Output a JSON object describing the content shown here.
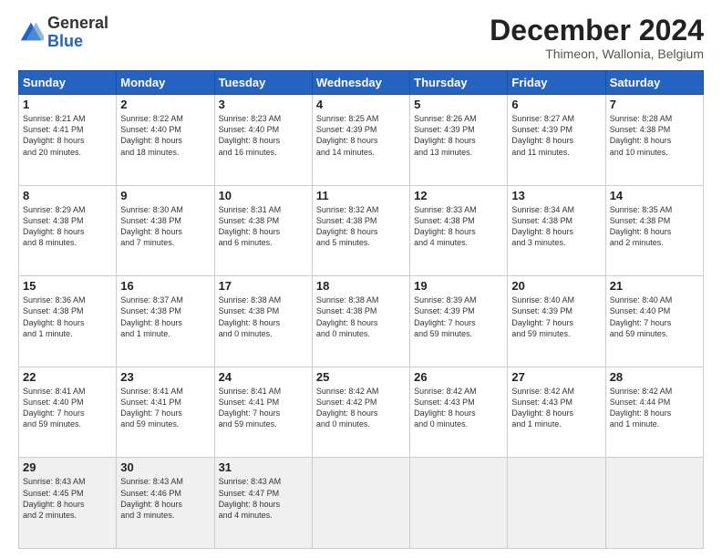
{
  "logo": {
    "general": "General",
    "blue": "Blue"
  },
  "header": {
    "month": "December 2024",
    "location": "Thimeon, Wallonia, Belgium"
  },
  "days_header": [
    "Sunday",
    "Monday",
    "Tuesday",
    "Wednesday",
    "Thursday",
    "Friday",
    "Saturday"
  ],
  "weeks": [
    [
      {
        "day": "1",
        "info": "Sunrise: 8:21 AM\nSunset: 4:41 PM\nDaylight: 8 hours\nand 20 minutes."
      },
      {
        "day": "2",
        "info": "Sunrise: 8:22 AM\nSunset: 4:40 PM\nDaylight: 8 hours\nand 18 minutes."
      },
      {
        "day": "3",
        "info": "Sunrise: 8:23 AM\nSunset: 4:40 PM\nDaylight: 8 hours\nand 16 minutes."
      },
      {
        "day": "4",
        "info": "Sunrise: 8:25 AM\nSunset: 4:39 PM\nDaylight: 8 hours\nand 14 minutes."
      },
      {
        "day": "5",
        "info": "Sunrise: 8:26 AM\nSunset: 4:39 PM\nDaylight: 8 hours\nand 13 minutes."
      },
      {
        "day": "6",
        "info": "Sunrise: 8:27 AM\nSunset: 4:39 PM\nDaylight: 8 hours\nand 11 minutes."
      },
      {
        "day": "7",
        "info": "Sunrise: 8:28 AM\nSunset: 4:38 PM\nDaylight: 8 hours\nand 10 minutes."
      }
    ],
    [
      {
        "day": "8",
        "info": "Sunrise: 8:29 AM\nSunset: 4:38 PM\nDaylight: 8 hours\nand 8 minutes."
      },
      {
        "day": "9",
        "info": "Sunrise: 8:30 AM\nSunset: 4:38 PM\nDaylight: 8 hours\nand 7 minutes."
      },
      {
        "day": "10",
        "info": "Sunrise: 8:31 AM\nSunset: 4:38 PM\nDaylight: 8 hours\nand 6 minutes."
      },
      {
        "day": "11",
        "info": "Sunrise: 8:32 AM\nSunset: 4:38 PM\nDaylight: 8 hours\nand 5 minutes."
      },
      {
        "day": "12",
        "info": "Sunrise: 8:33 AM\nSunset: 4:38 PM\nDaylight: 8 hours\nand 4 minutes."
      },
      {
        "day": "13",
        "info": "Sunrise: 8:34 AM\nSunset: 4:38 PM\nDaylight: 8 hours\nand 3 minutes."
      },
      {
        "day": "14",
        "info": "Sunrise: 8:35 AM\nSunset: 4:38 PM\nDaylight: 8 hours\nand 2 minutes."
      }
    ],
    [
      {
        "day": "15",
        "info": "Sunrise: 8:36 AM\nSunset: 4:38 PM\nDaylight: 8 hours\nand 1 minute."
      },
      {
        "day": "16",
        "info": "Sunrise: 8:37 AM\nSunset: 4:38 PM\nDaylight: 8 hours\nand 1 minute."
      },
      {
        "day": "17",
        "info": "Sunrise: 8:38 AM\nSunset: 4:38 PM\nDaylight: 8 hours\nand 0 minutes."
      },
      {
        "day": "18",
        "info": "Sunrise: 8:38 AM\nSunset: 4:38 PM\nDaylight: 8 hours\nand 0 minutes."
      },
      {
        "day": "19",
        "info": "Sunrise: 8:39 AM\nSunset: 4:39 PM\nDaylight: 7 hours\nand 59 minutes."
      },
      {
        "day": "20",
        "info": "Sunrise: 8:40 AM\nSunset: 4:39 PM\nDaylight: 7 hours\nand 59 minutes."
      },
      {
        "day": "21",
        "info": "Sunrise: 8:40 AM\nSunset: 4:40 PM\nDaylight: 7 hours\nand 59 minutes."
      }
    ],
    [
      {
        "day": "22",
        "info": "Sunrise: 8:41 AM\nSunset: 4:40 PM\nDaylight: 7 hours\nand 59 minutes."
      },
      {
        "day": "23",
        "info": "Sunrise: 8:41 AM\nSunset: 4:41 PM\nDaylight: 7 hours\nand 59 minutes."
      },
      {
        "day": "24",
        "info": "Sunrise: 8:41 AM\nSunset: 4:41 PM\nDaylight: 7 hours\nand 59 minutes."
      },
      {
        "day": "25",
        "info": "Sunrise: 8:42 AM\nSunset: 4:42 PM\nDaylight: 8 hours\nand 0 minutes."
      },
      {
        "day": "26",
        "info": "Sunrise: 8:42 AM\nSunset: 4:43 PM\nDaylight: 8 hours\nand 0 minutes."
      },
      {
        "day": "27",
        "info": "Sunrise: 8:42 AM\nSunset: 4:43 PM\nDaylight: 8 hours\nand 1 minute."
      },
      {
        "day": "28",
        "info": "Sunrise: 8:42 AM\nSunset: 4:44 PM\nDaylight: 8 hours\nand 1 minute."
      }
    ],
    [
      {
        "day": "29",
        "info": "Sunrise: 8:43 AM\nSunset: 4:45 PM\nDaylight: 8 hours\nand 2 minutes."
      },
      {
        "day": "30",
        "info": "Sunrise: 8:43 AM\nSunset: 4:46 PM\nDaylight: 8 hours\nand 3 minutes."
      },
      {
        "day": "31",
        "info": "Sunrise: 8:43 AM\nSunset: 4:47 PM\nDaylight: 8 hours\nand 4 minutes."
      },
      null,
      null,
      null,
      null
    ]
  ]
}
